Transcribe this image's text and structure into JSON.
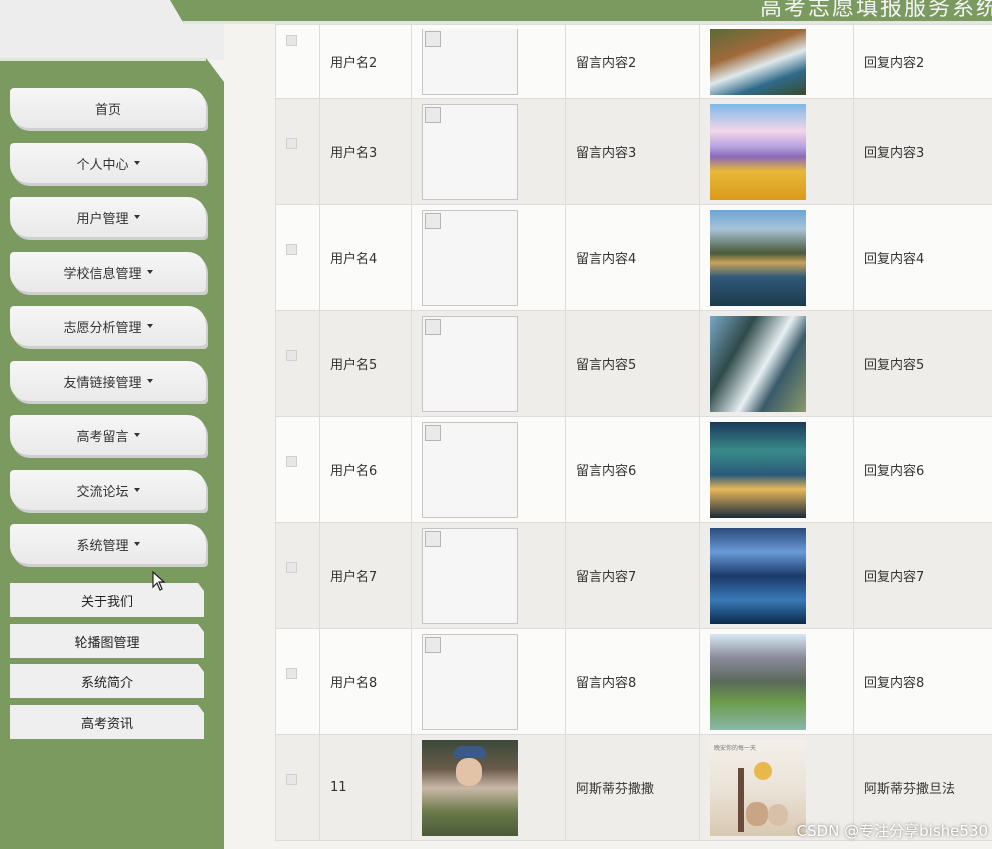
{
  "header": {
    "site_title": "高考志愿填报服务系统"
  },
  "sidebar": {
    "items": [
      {
        "label": "首页",
        "caret": false
      },
      {
        "label": "个人中心",
        "caret": true
      },
      {
        "label": "用户管理",
        "caret": true
      },
      {
        "label": "学校信息管理",
        "caret": true
      },
      {
        "label": "志愿分析管理",
        "caret": true
      },
      {
        "label": "友情链接管理",
        "caret": true
      },
      {
        "label": "高考留言",
        "caret": true
      },
      {
        "label": "交流论坛",
        "caret": true
      },
      {
        "label": "系统管理",
        "caret": true
      }
    ],
    "sub_items": [
      "关于我们",
      "轮播图管理",
      "系统简介",
      "高考资讯"
    ]
  },
  "table": {
    "rows": [
      {
        "username": "用户名2",
        "avatar": "broken",
        "content": "留言内容2",
        "picture": "waterfall-bridge",
        "reply": "回复内容2"
      },
      {
        "username": "用户名3",
        "avatar": "broken",
        "content": "留言内容3",
        "picture": "flower-field",
        "reply": "回复内容3"
      },
      {
        "username": "用户名4",
        "avatar": "broken",
        "content": "留言内容4",
        "picture": "mountain-lake",
        "reply": "回复内容4"
      },
      {
        "username": "用户名5",
        "avatar": "broken",
        "content": "留言内容5",
        "picture": "cliff-waterfall",
        "reply": "回复内容5"
      },
      {
        "username": "用户名6",
        "avatar": "broken",
        "content": "留言内容6",
        "picture": "aurora-cabin",
        "reply": "回复内容6"
      },
      {
        "username": "用户名7",
        "avatar": "broken",
        "content": "留言内容7",
        "picture": "rocky-lake",
        "reply": "回复内容7"
      },
      {
        "username": "用户名8",
        "avatar": "broken",
        "content": "留言内容8",
        "picture": "river-gorge",
        "reply": "回复内容8"
      },
      {
        "username": "11",
        "avatar": "woman-portrait",
        "content": "阿斯蒂芬撒撒",
        "picture": "lamp-bears",
        "reply": "阿斯蒂芬撒旦法"
      }
    ]
  },
  "thumb_caption": "晚安你的每一天",
  "watermark": "CSDN @专注分享bishe530"
}
